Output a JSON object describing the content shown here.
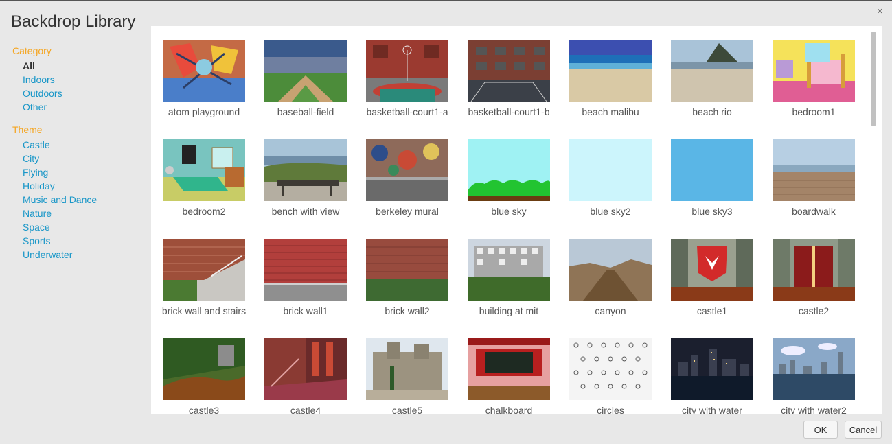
{
  "dialog": {
    "title": "Backdrop Library",
    "close_glyph": "×"
  },
  "sidebar": {
    "category_heading": "Category",
    "categories": [
      "All",
      "Indoors",
      "Outdoors",
      "Other"
    ],
    "selected_category": "All",
    "theme_heading": "Theme",
    "themes": [
      "Castle",
      "City",
      "Flying",
      "Holiday",
      "Music and Dance",
      "Nature",
      "Space",
      "Sports",
      "Underwater"
    ],
    "heading_color": "#f5a623",
    "link_color": "#1a97c8"
  },
  "library": {
    "items": [
      "atom playground",
      "baseball-field",
      "basketball-court1-a",
      "basketball-court1-b",
      "beach malibu",
      "beach rio",
      "bedroom1",
      "bedroom2",
      "bench with view",
      "berkeley mural",
      "blue sky",
      "blue sky2",
      "blue sky3",
      "boardwalk",
      "brick wall and stairs",
      "brick wall1",
      "brick wall2",
      "building at mit",
      "canyon",
      "castle1",
      "castle2",
      "castle3",
      "castle4",
      "castle5",
      "chalkboard",
      "circles",
      "city with water",
      "city with water2"
    ]
  },
  "footer": {
    "ok_label": "OK",
    "cancel_label": "Cancel"
  }
}
